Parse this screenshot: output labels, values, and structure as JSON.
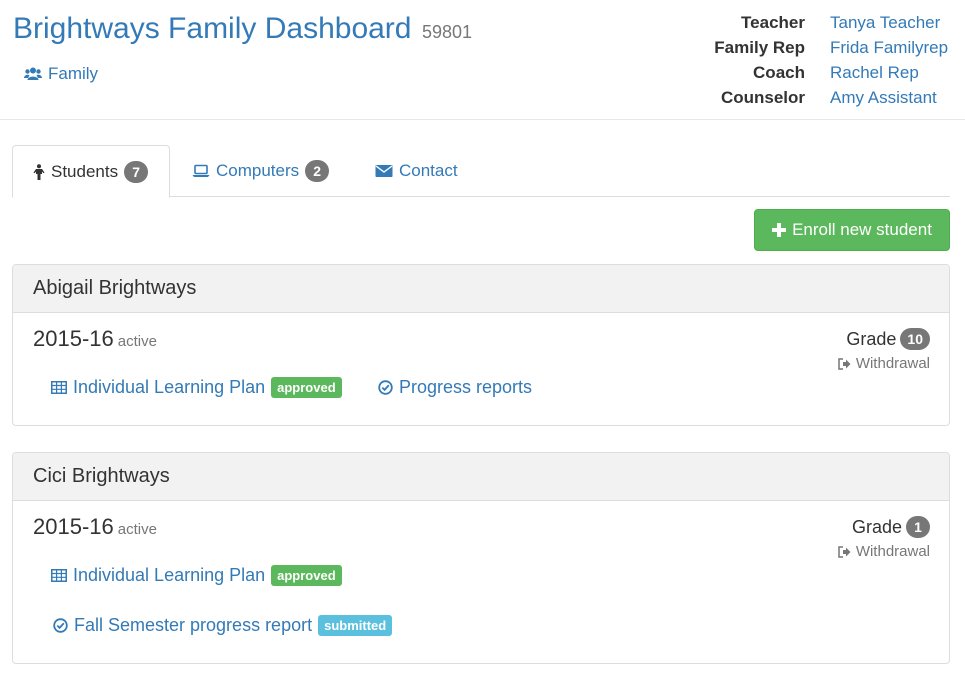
{
  "header": {
    "title": "Brightways Family Dashboard",
    "family_id": "59801",
    "family_link": "Family"
  },
  "staff": [
    {
      "role": "Teacher",
      "name": "Tanya Teacher"
    },
    {
      "role": "Family Rep",
      "name": "Frida Familyrep"
    },
    {
      "role": "Coach",
      "name": "Rachel Rep"
    },
    {
      "role": "Counselor",
      "name": "Amy Assistant"
    }
  ],
  "tabs": [
    {
      "label": "Students",
      "count": "7",
      "icon": "student-icon",
      "active": true
    },
    {
      "label": "Computers",
      "count": "2",
      "icon": "laptop-icon",
      "active": false
    },
    {
      "label": "Contact",
      "icon": "envelope-icon",
      "active": false
    }
  ],
  "enroll_button": "Enroll new student",
  "students": [
    {
      "name": "Abigail Brightways",
      "year": "2015-16",
      "status": "active",
      "grade_label": "Grade",
      "grade": "10",
      "withdrawal": "Withdrawal",
      "links": [
        {
          "label": "Individual Learning Plan",
          "badge": "approved",
          "icon": "table-icon"
        },
        {
          "label": "Progress reports",
          "icon": "check-circle-icon"
        }
      ]
    },
    {
      "name": "Cici Brightways",
      "year": "2015-16",
      "status": "active",
      "grade_label": "Grade",
      "grade": "1",
      "withdrawal": "Withdrawal",
      "links": [
        {
          "label": "Individual Learning Plan",
          "badge": "approved",
          "icon": "table-icon"
        },
        {
          "label": "Fall Semester progress report",
          "badge": "submitted",
          "icon": "check-circle-icon"
        }
      ]
    }
  ],
  "colors": {
    "link": "#337ab7",
    "success": "#5cb85c",
    "info": "#5bc0de",
    "badge": "#777777"
  }
}
